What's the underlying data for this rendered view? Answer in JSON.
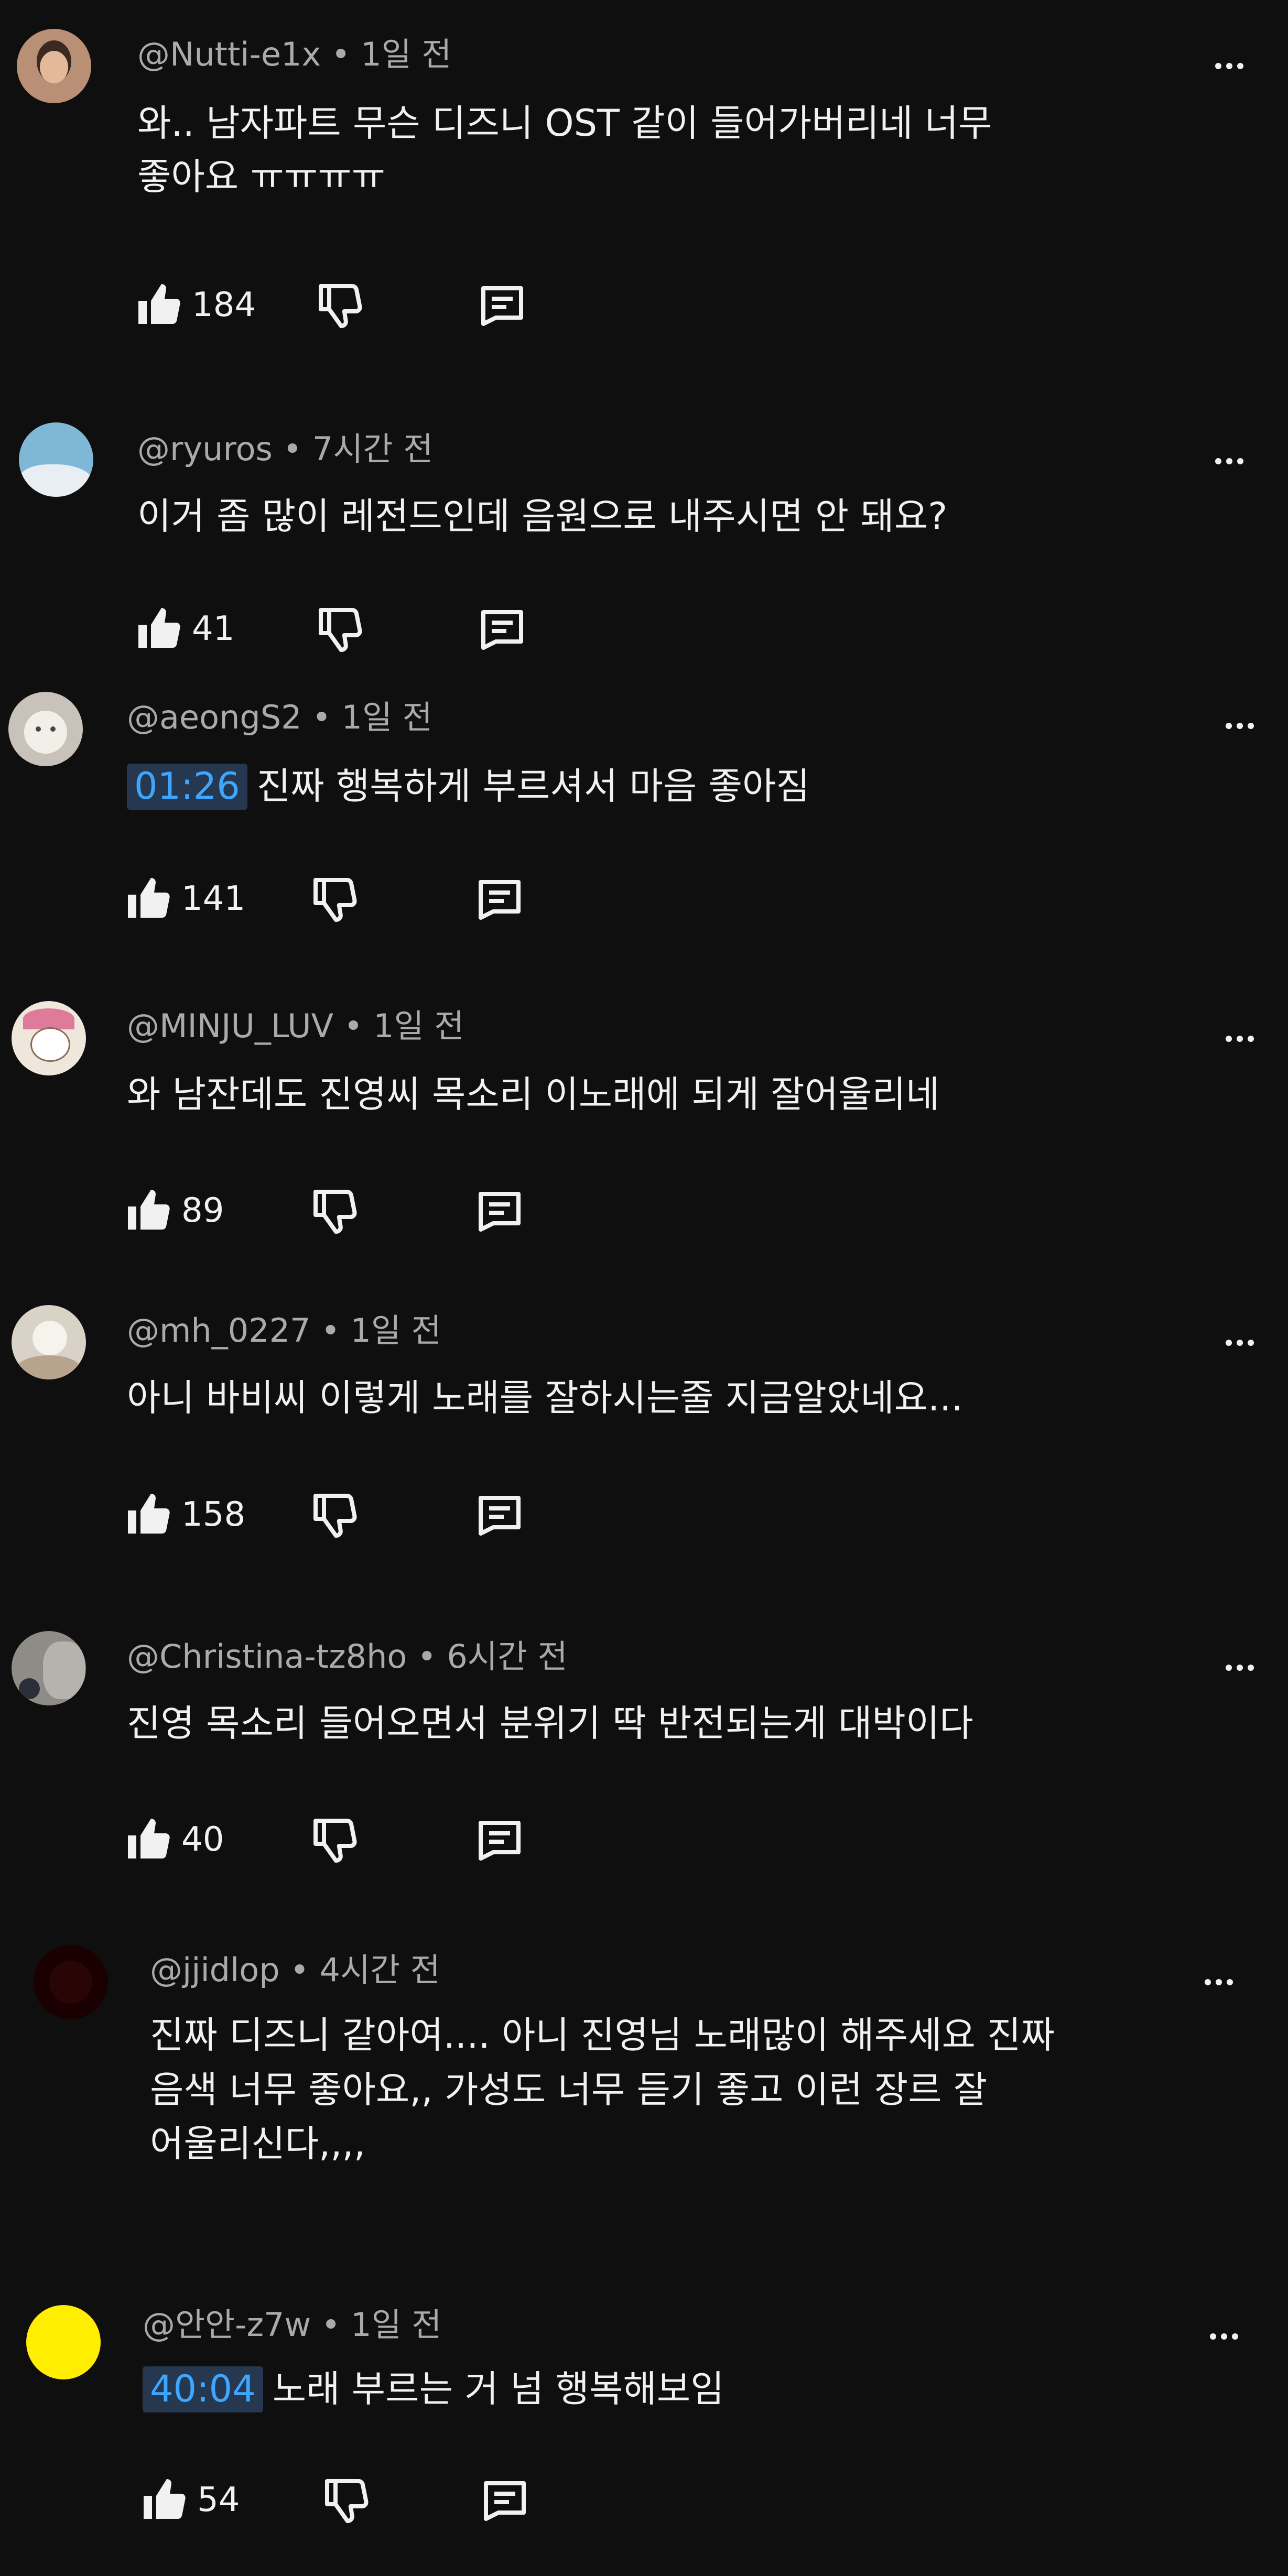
{
  "comments": [
    {
      "handle": "@Nutti-e1x",
      "time": "1일 전",
      "timestamp": "",
      "lines": [
        "와.. 남자파트 무슨 디즈니 OST 같이 들어가버리네 너무",
        "좋아요 ㅠㅠㅠㅠ"
      ],
      "likes": "184",
      "avatar_color": "#b98f75"
    },
    {
      "handle": "@ryuros",
      "time": "7시간 전",
      "timestamp": "",
      "lines": [
        "이거 좀 많이 레전드인데 음원으로 내주시면 안 돼요?"
      ],
      "likes": "41",
      "avatar_color": "#7fb7d6"
    },
    {
      "handle": "@aeongS2",
      "time": "1일 전",
      "timestamp": "01:26",
      "lines": [
        "진짜 행복하게 부르셔서 마음 좋아짐"
      ],
      "likes": "141",
      "avatar_color": "#c8c2bb"
    },
    {
      "handle": "@MINJU_LUV",
      "time": "1일 전",
      "timestamp": "",
      "lines": [
        "와 남잔데도 진영씨 목소리 이노래에 되게 잘어울리네"
      ],
      "likes": "89",
      "avatar_color": "#efe7dc"
    },
    {
      "handle": "@mh_0227",
      "time": "1일 전",
      "timestamp": "",
      "lines": [
        "아니 바비씨 이렇게 노래를 잘하시는줄 지금알았네요..."
      ],
      "likes": "158",
      "avatar_color": "#d9d2c6"
    },
    {
      "handle": "@Christina-tz8ho",
      "time": "6시간 전",
      "timestamp": "",
      "lines": [
        "진영 목소리 들어오면서 분위기 딱 반전되는게 대박이다"
      ],
      "likes": "40",
      "avatar_color": "#8f8c88"
    },
    {
      "handle": "@jjidlop",
      "time": "4시간 전",
      "timestamp": "",
      "lines": [
        "진짜 디즈니 같아여.... 아니 진영님 노래많이 해주세요 진짜",
        "음색 너무 좋아요,, 가성도 너무 듣기 좋고 이런 장르 잘",
        "어울리신다,,,,"
      ],
      "likes": "",
      "avatar_color": "#1a0000"
    },
    {
      "handle": "@안안-z7w",
      "time": "1일 전",
      "timestamp": "40:04",
      "lines": [
        "노래 부르는 거 넘 행복해보임"
      ],
      "likes": "54",
      "avatar_color": "#ffee00"
    }
  ],
  "icons": {
    "like": "thumbs-up-icon",
    "dislike": "thumbs-down-icon",
    "reply": "reply-icon",
    "more": "more-vert-icon"
  }
}
